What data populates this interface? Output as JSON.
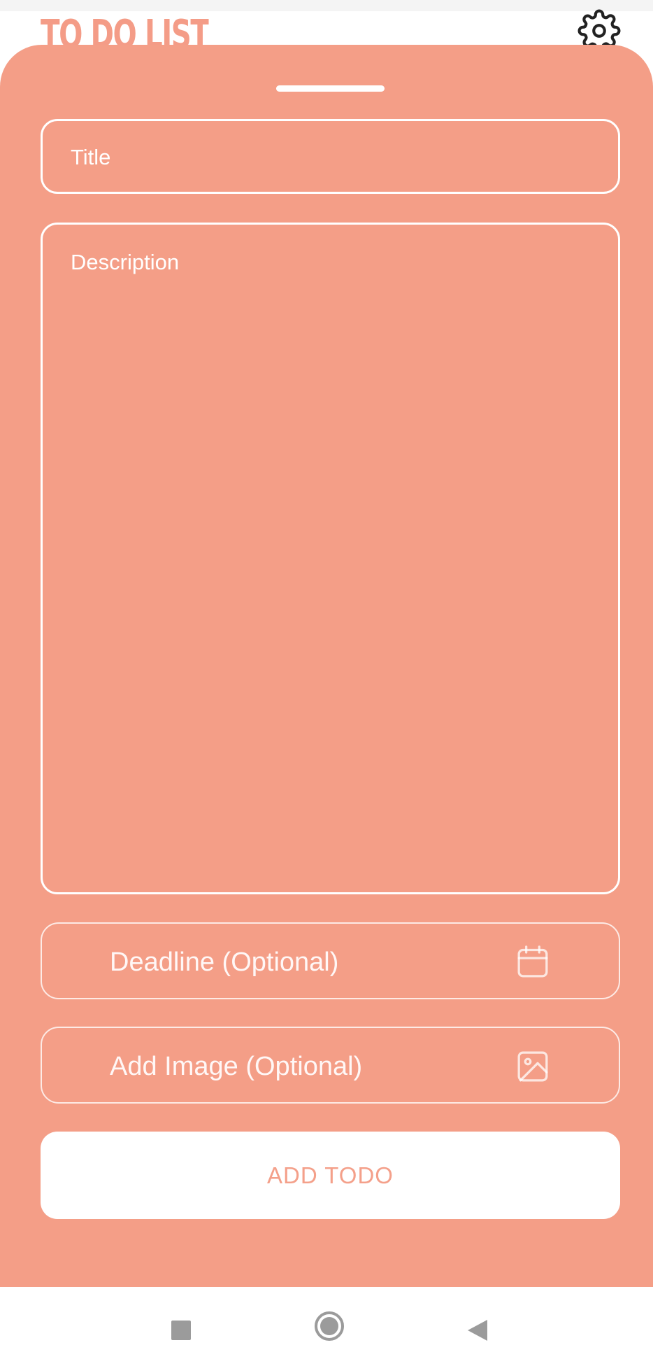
{
  "app": {
    "title": "TO DO LIST"
  },
  "form": {
    "title_placeholder": "Title",
    "description_placeholder": "Description",
    "deadline_label": "Deadline (Optional)",
    "image_label": "Add Image (Optional)",
    "submit_label": "ADD TODO"
  },
  "icons": {
    "settings": "gear-icon",
    "deadline": "calendar-icon",
    "image": "image-icon",
    "nav_recents": "square-icon",
    "nav_home": "circle-icon",
    "nav_back": "triangle-back-icon"
  },
  "colors": {
    "accent": "#f49e87",
    "title_text": "#f49c87",
    "button_text": "#f4a08a",
    "surface": "#ffffff"
  }
}
